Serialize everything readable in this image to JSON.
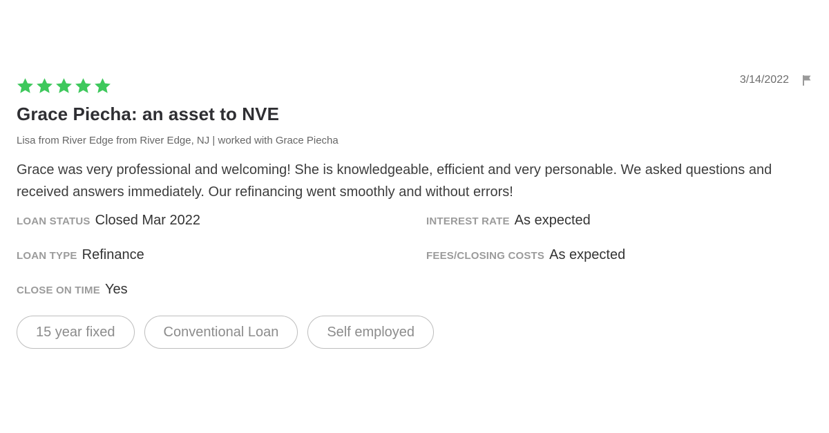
{
  "review": {
    "rating": 5,
    "date": "3/14/2022",
    "title": "Grace Piecha: an asset to NVE",
    "byline": "Lisa from River Edge from River Edge, NJ | worked with Grace Piecha",
    "body": "Grace was very professional and welcoming! She is knowledgeable, efficient and very personable. We asked questions and received answers immediately. Our refinancing went smoothly and without errors!",
    "details": {
      "loan_status": {
        "label": "LOAN STATUS",
        "value": "Closed Mar 2022"
      },
      "interest_rate": {
        "label": "INTEREST RATE",
        "value": "As expected"
      },
      "loan_type": {
        "label": "LOAN TYPE",
        "value": "Refinance"
      },
      "fees": {
        "label": "FEES/CLOSING COSTS",
        "value": "As expected"
      },
      "close_on_time": {
        "label": "CLOSE ON TIME",
        "value": "Yes"
      }
    },
    "tags": [
      "15 year fixed",
      "Conventional Loan",
      "Self employed"
    ]
  },
  "icons": {
    "star": "star-icon",
    "flag": "flag-icon"
  },
  "colors": {
    "star": "#3ec85c",
    "flag": "#9a9a9a",
    "tag_border": "#bdbdbd"
  }
}
